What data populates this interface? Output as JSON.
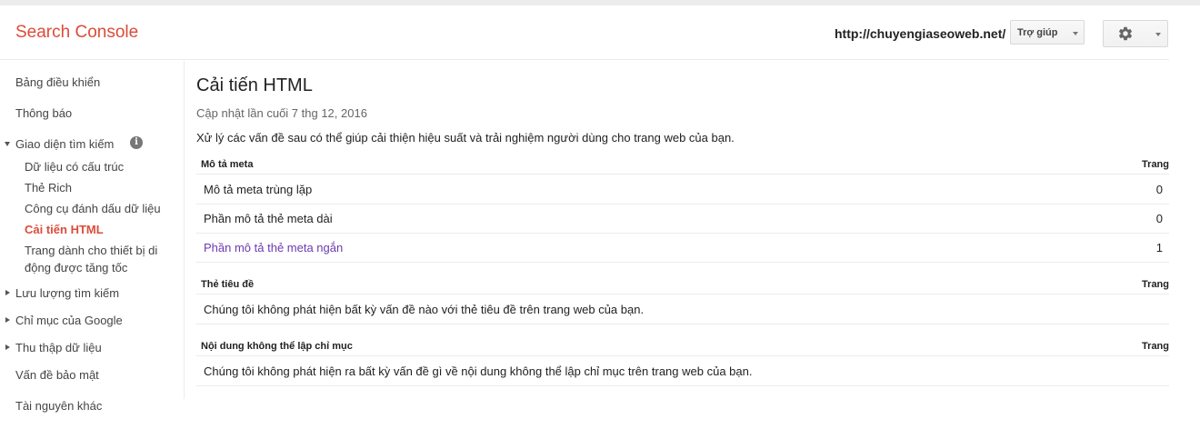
{
  "header": {
    "brand": "Search Console",
    "site_url": "http://chuyengiaseoweb.net/",
    "help_label": "Trợ giúp",
    "settings_icon": "gear-icon"
  },
  "sidebar": {
    "items": [
      {
        "label": "Bảng điều khiển"
      },
      {
        "label": "Thông báo"
      },
      {
        "label": "Giao diện tìm kiếm",
        "expanded": true
      },
      {
        "label": "Dữ liệu có cấu trúc"
      },
      {
        "label": "Thẻ Rich"
      },
      {
        "label": "Công cụ đánh dấu dữ liệu"
      },
      {
        "label": "Cải tiến HTML",
        "active": true
      },
      {
        "label_line1": "Trang dành cho thiết bị di",
        "label_line2": "động được tăng tốc"
      },
      {
        "label": "Lưu lượng tìm kiếm"
      },
      {
        "label": "Chỉ mục của Google"
      },
      {
        "label": "Thu thập dữ liệu"
      },
      {
        "label": "Vấn đề bảo mật"
      },
      {
        "label": "Tài nguyên khác"
      }
    ]
  },
  "main": {
    "title": "Cải tiến HTML",
    "updated": "Cập nhật lần cuối 7 thg 12, 2016",
    "description": "Xử lý các vấn đề sau có thể giúp cải thiện hiệu suất và trải nghiệm người dùng cho trang web của bạn.",
    "sections": [
      {
        "header": "Mô tả meta",
        "column": "Trang",
        "rows": [
          {
            "label": "Mô tả meta trùng lặp",
            "value": "0"
          },
          {
            "label": "Phần mô tả thẻ meta dài",
            "value": "0"
          },
          {
            "label": "Phần mô tả thẻ meta ngắn",
            "value": "1",
            "link": true
          }
        ]
      },
      {
        "header": "Thẻ tiêu đề",
        "column": "Trang",
        "rows": [
          {
            "label": "Chúng tôi không phát hiện bất kỳ vấn đề nào với thẻ tiêu đề trên trang web của bạn."
          }
        ]
      },
      {
        "header": "Nội dung không thể lập chỉ mục",
        "column": "Trang",
        "rows": [
          {
            "label": "Chúng tôi không phát hiện ra bất kỳ vấn đề gì về nội dung không thể lập chỉ mục trên trang web của bạn."
          }
        ]
      }
    ]
  },
  "colors": {
    "brand": "#dd4b39",
    "active_nav": "#dd4b39",
    "link": "#6a3ab2"
  }
}
